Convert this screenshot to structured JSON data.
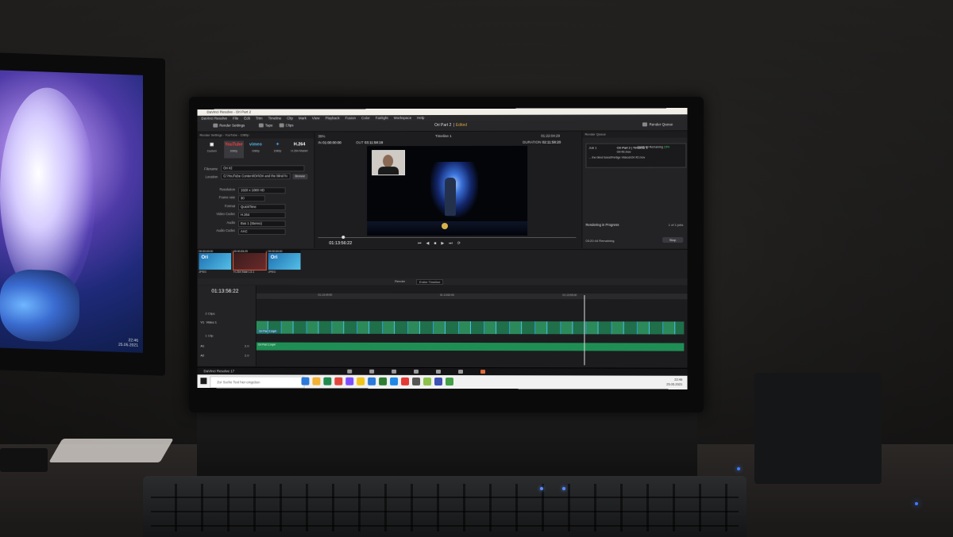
{
  "app": {
    "window_title": "DaVinci Resolve - Ori Part 2",
    "menu": [
      "DaVinci Resolve",
      "File",
      "Edit",
      "Trim",
      "Timeline",
      "Clip",
      "Mark",
      "View",
      "Playback",
      "Fusion",
      "Color",
      "Fairlight",
      "Workspace",
      "Help"
    ],
    "toolbar": {
      "render_settings": "Render Settings",
      "tape": "Tape",
      "clips": "Clips",
      "project_title": "Ori Part 2",
      "edited": "Edited",
      "render_queue": "Render Queue"
    }
  },
  "render_settings": {
    "header": "Render Settings - YouTube - 1080p",
    "presets": [
      {
        "logo": "",
        "label": "Custom"
      },
      {
        "logo": "YouTube",
        "label": "1080p"
      },
      {
        "logo": "vimeo",
        "label": "1080p"
      },
      {
        "logo": "✦",
        "label": "1080p"
      },
      {
        "logo": "H.264",
        "label": "H.264 Master"
      }
    ],
    "filename_label": "Filename",
    "filename": "Ori #2",
    "location_label": "Location",
    "location": "G:\\YouTube Content\\Ori\\Ori and the blind fo",
    "browse": "Browse",
    "settings": [
      {
        "label": "Resolution",
        "value": "1920 x 1080 HD"
      },
      {
        "label": "Frame rate",
        "value": "30"
      },
      {
        "label": "Format",
        "value": "QuickTime"
      },
      {
        "label": "Video Codec",
        "value": "H.264"
      },
      {
        "label": "Audio",
        "value": "Bus 1 (Stereo)"
      },
      {
        "label": "Audio Codec",
        "value": "AAC"
      }
    ],
    "add_to_queue": "Add to Render Queue"
  },
  "viewer": {
    "zoom": "39%",
    "in_label": "IN",
    "in_tc": "01:00:00:00",
    "out_label": "OUT",
    "out_tc": "03:11:58:19",
    "timeline_name": "Timeline 1",
    "top_right_tc": "01:22:04:29",
    "duration_label": "DURATION",
    "duration": "02:11:58:20",
    "current_tc": "01:13:56:22"
  },
  "render_queue": {
    "title": "Render Queue",
    "job": {
      "name": "Job 1",
      "remaining": "03:05:49 Remaining",
      "percent": "15%",
      "project": "Ori Part 2 | Timeline 1",
      "line3": "Ori #2.mov",
      "line4": "... the blind forest\\Fertige Videos\\Ori #2.mov",
      "line5": ""
    },
    "progress_label": "Rendering in Progress",
    "count": "1 of 1 jobs",
    "remaining": "03:20:44 Remaining",
    "stop": "Stop"
  },
  "clips": [
    {
      "tc": "00:00:00:00",
      "track": "V2",
      "title": "Ori",
      "name": "JPEG",
      "selected": false
    },
    {
      "tc": "00:00:35:29",
      "track": "V1",
      "title": "",
      "name": "H.264 Main L5.1",
      "selected": true
    },
    {
      "tc": "00:00:00:00",
      "track": "V2",
      "title": "Ori",
      "name": "JPEG",
      "selected": false
    }
  ],
  "timeline": {
    "render_label": "Render",
    "render_mode": "Entire Timeline",
    "current_tc": "01:13:56:22",
    "ruler": [
      "01:13:49:00",
      "01:13:52:00",
      "01:13:55:00"
    ],
    "tracks": [
      {
        "id": "V2",
        "name": "",
        "count": "2 Clips"
      },
      {
        "id": "V1",
        "name": "Video 1",
        "count": "1 Clip"
      },
      {
        "id": "A1",
        "name": "",
        "count": "2.0"
      },
      {
        "id": "A2",
        "name": "",
        "count": "2.0"
      }
    ],
    "v1_clip": "Ori Part 2.mp4",
    "a1_clip": "Ori Part 2.mp4"
  },
  "bottom": {
    "app_name": "DaVinci Resolve 17",
    "pages": [
      "media",
      "cut",
      "edit",
      "fusion",
      "color",
      "fairlight",
      "deliver"
    ],
    "active_page": "deliver"
  },
  "taskbar": {
    "search_placeholder": "Zur Suche Text hier eingeben",
    "time": "22:46",
    "date": "25.05.2021",
    "app_colors": [
      "#2b79d9",
      "#f2b134",
      "#1f8b4c",
      "#e2453c",
      "#7c4dff",
      "#f0c419",
      "#2b79d9",
      "#2e7d32",
      "#1e88e5",
      "#e53935",
      "#555555",
      "#8bc34a",
      "#3f51b5",
      "#43a047"
    ]
  },
  "left_monitor": {
    "time": "22:46",
    "date": "25.05.2021"
  },
  "colors": {
    "edited_accent": "#d7a23a",
    "video_clip": "#2c8a5a",
    "audio_clip": "#1f8e55",
    "progress_green": "#4bd36a",
    "deliver_active": "#e06a3a"
  }
}
